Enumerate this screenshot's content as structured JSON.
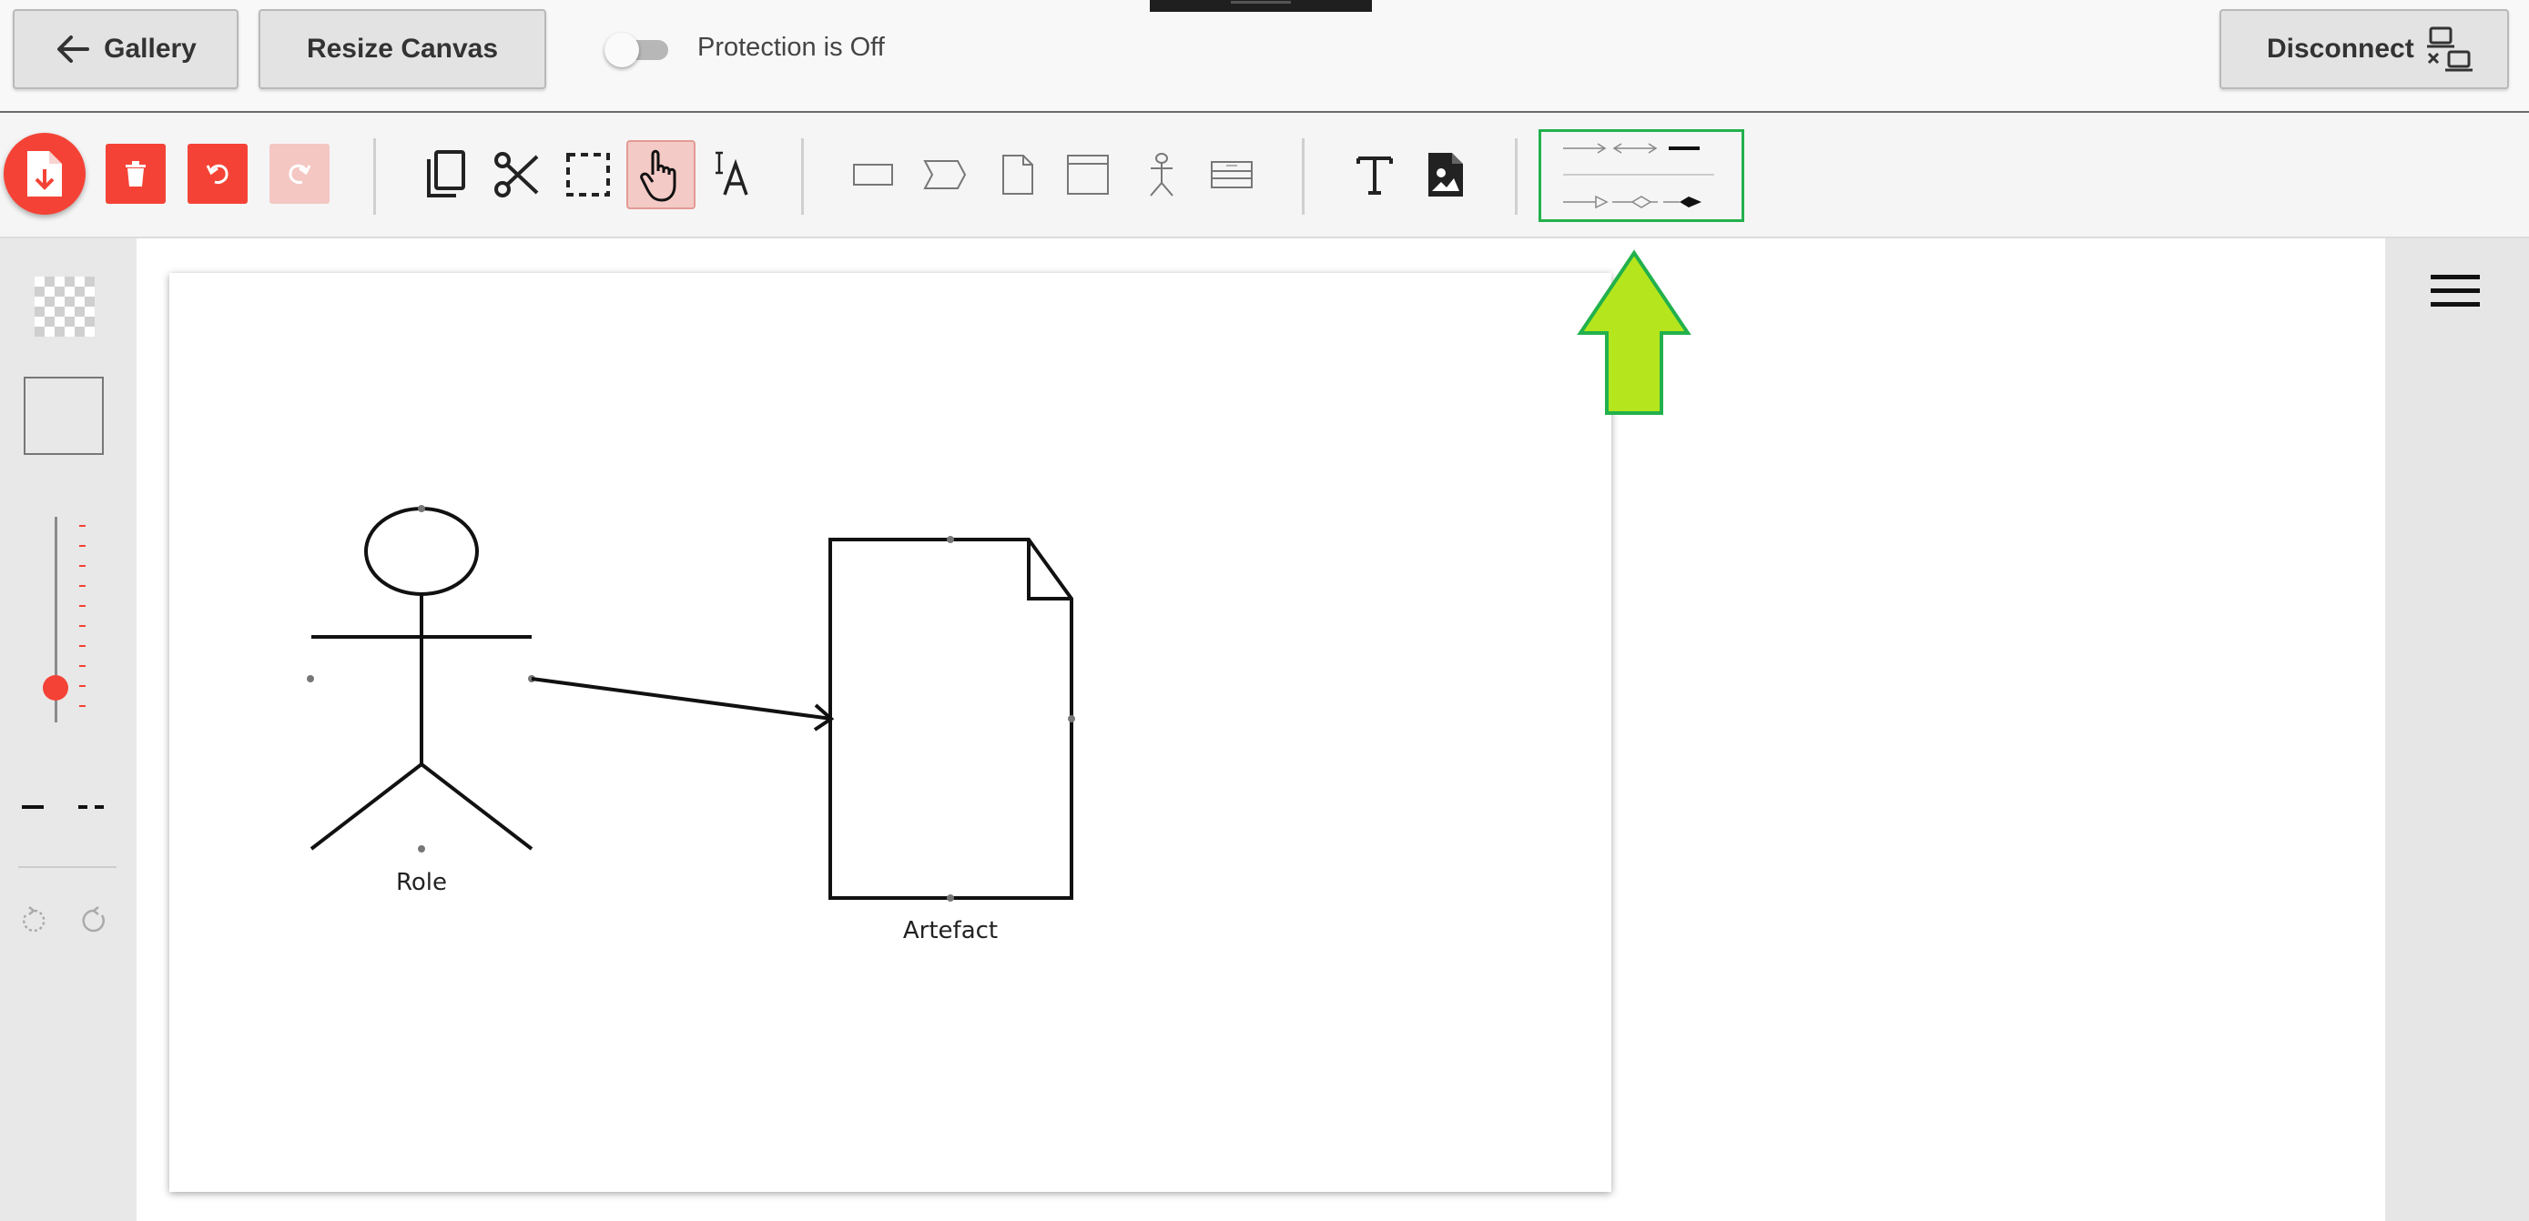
{
  "header": {
    "gallery_label": "Gallery",
    "resize_label": "Resize Canvas",
    "protection_label": "Protection is Off",
    "disconnect_label": "Disconnect"
  },
  "toolbar": {
    "tools": [
      "save",
      "delete",
      "undo",
      "redo",
      "copy",
      "cut",
      "select",
      "pan",
      "text-format",
      "rectangle",
      "chevron",
      "document",
      "window",
      "actor",
      "table",
      "text",
      "image",
      "line-styles"
    ]
  },
  "diagram": {
    "shapes": [
      {
        "type": "actor",
        "label": "Role"
      },
      {
        "type": "document",
        "label": "Artefact"
      }
    ],
    "connectors": [
      {
        "from": "Role",
        "to": "Artefact",
        "style": "open-arrow"
      }
    ]
  },
  "colors": {
    "accent": "#f44336",
    "accent_disabled": "#f4c7c3",
    "highlight_border": "#22b14c",
    "hint_arrow": "#b5e61d"
  }
}
